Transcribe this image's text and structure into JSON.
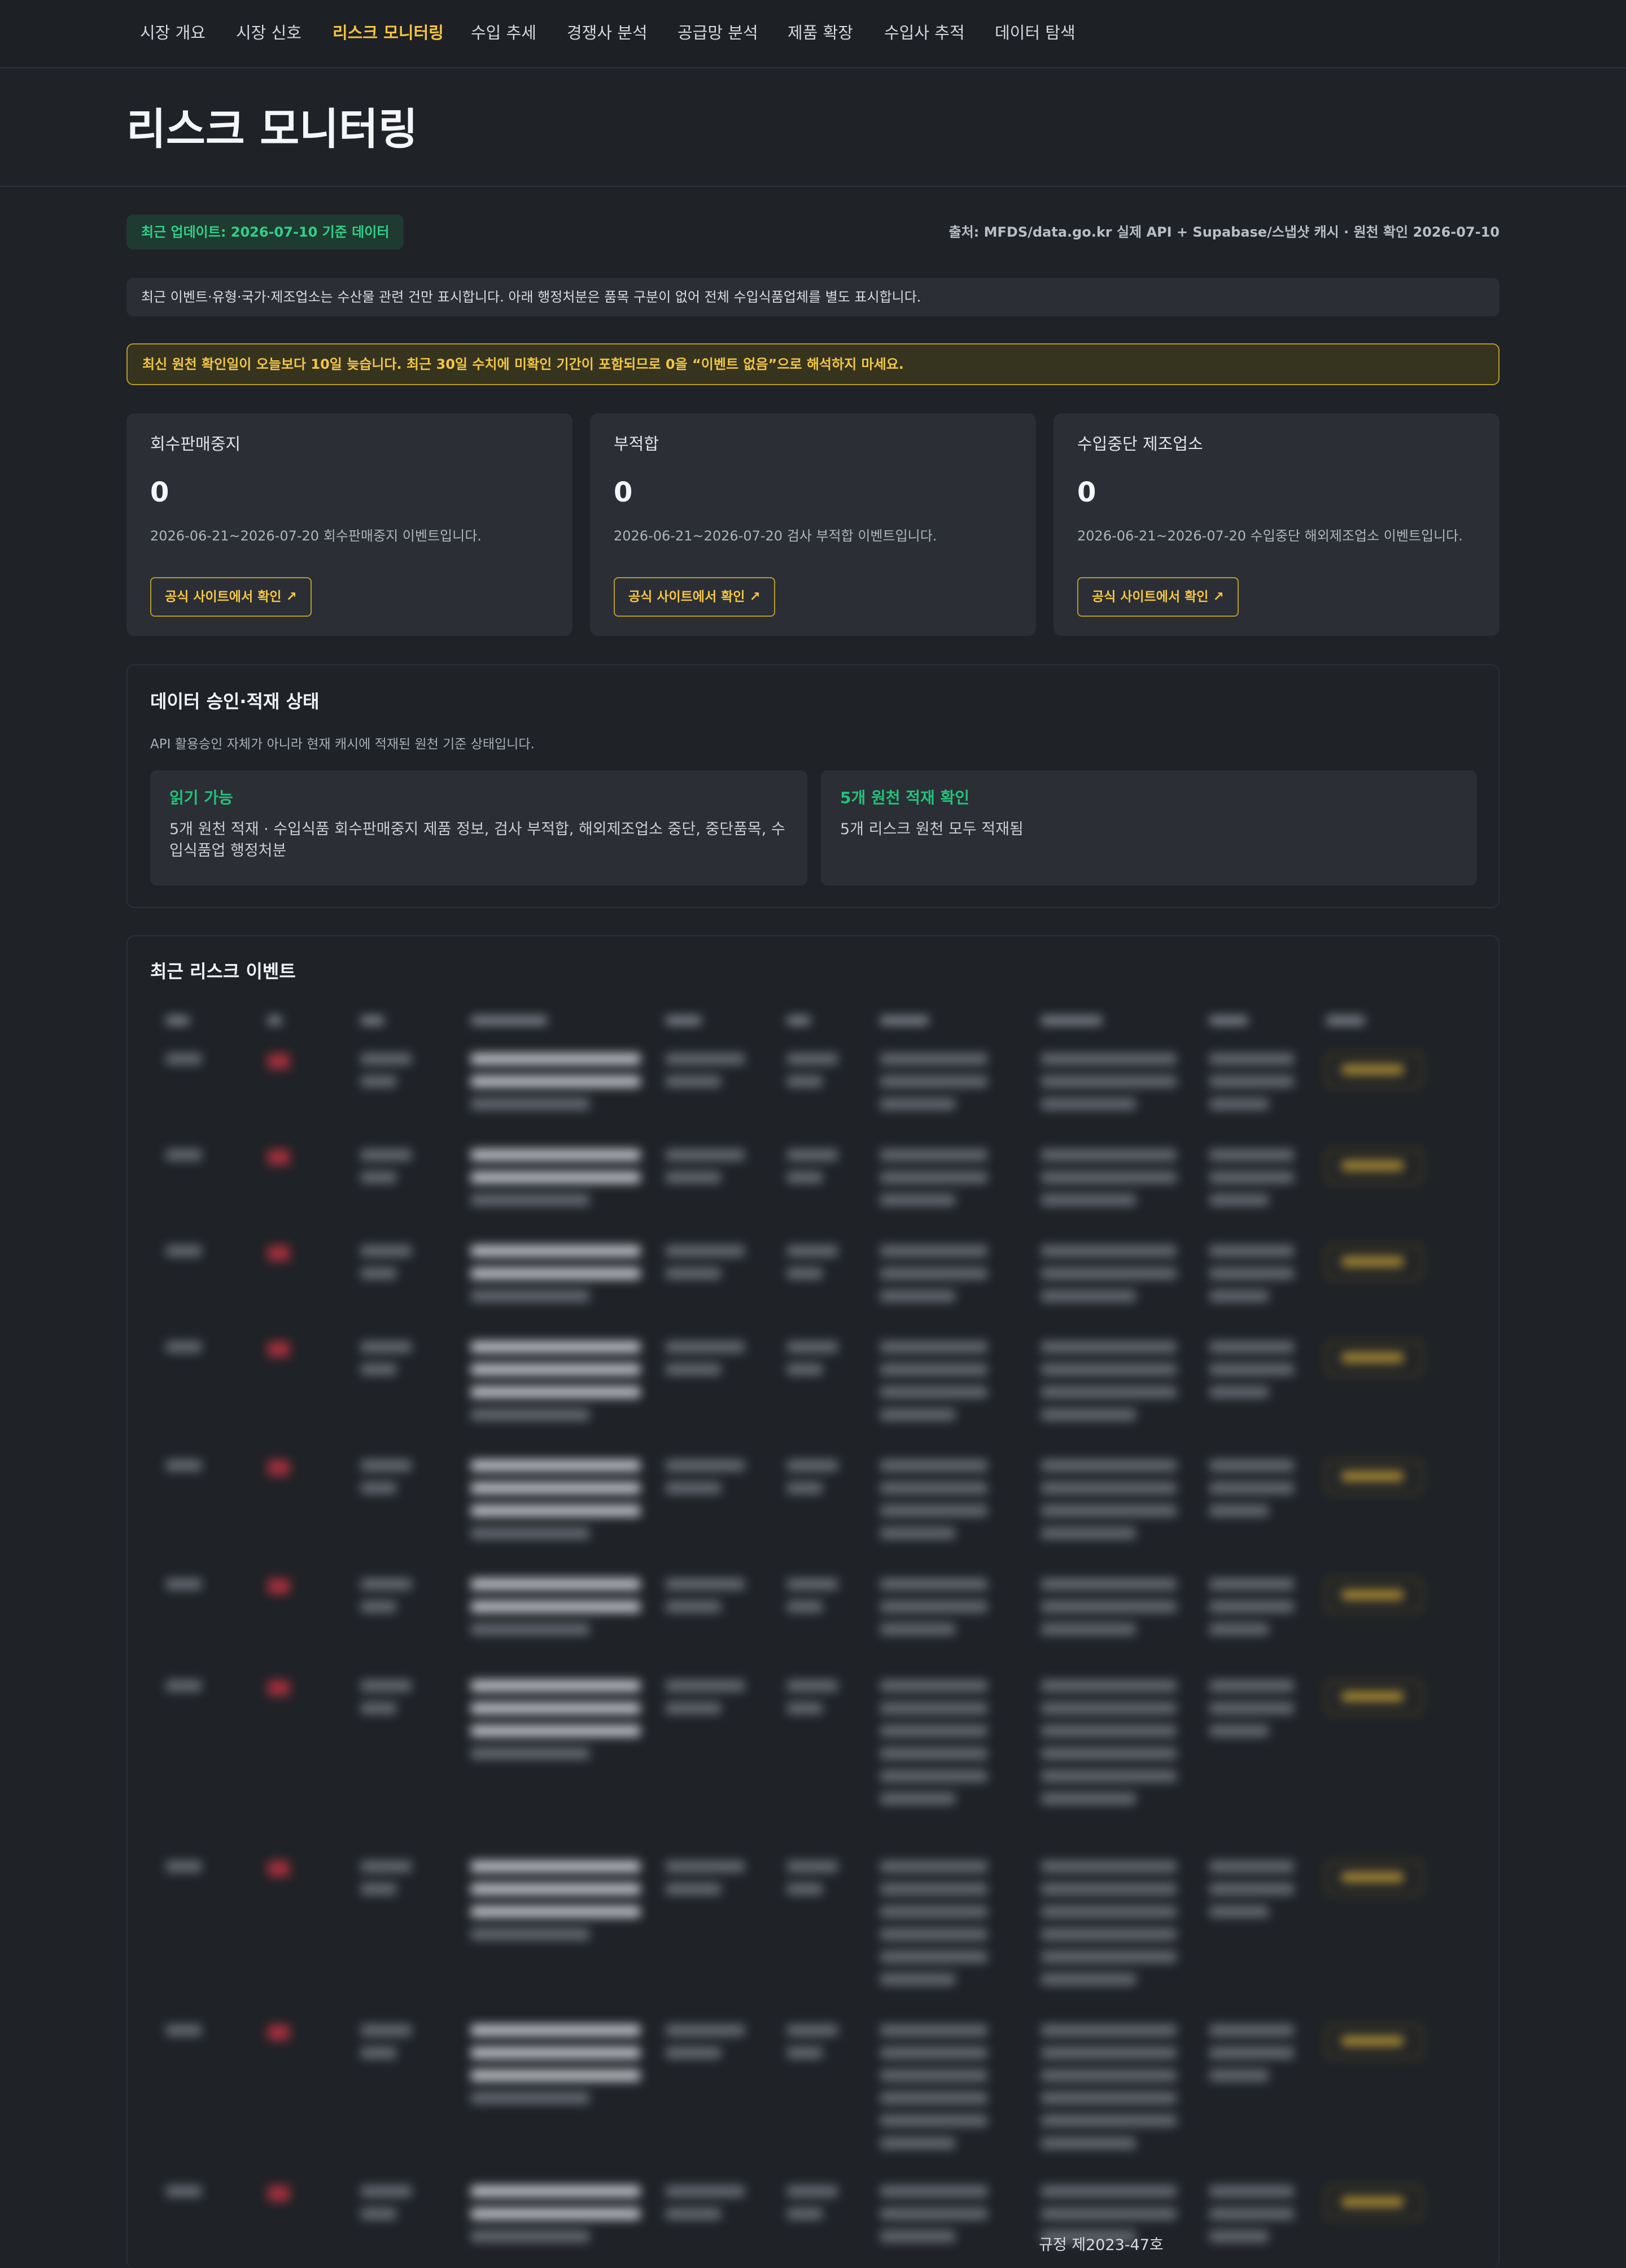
{
  "nav": {
    "tabs": [
      {
        "label": "시장 개요"
      },
      {
        "label": "시장 신호"
      },
      {
        "label": "리스크 모니터링",
        "active": true
      },
      {
        "label": "수입 추세"
      },
      {
        "label": "경쟁사 분석"
      },
      {
        "label": "공급망 분석"
      },
      {
        "label": "제품 확장"
      },
      {
        "label": "수입사 추적"
      },
      {
        "label": "데이터 탐색"
      }
    ]
  },
  "header": {
    "title": "리스크 모니터링"
  },
  "status": {
    "update_badge": "최근 업데이트: 2026-07-10 기준 데이터",
    "source": "출처: MFDS/data.go.kr 실제 API + Supabase/스냅샷 캐시 · 원천 확인 2026-07-10"
  },
  "info_note": "최근 이벤트·유형·국가·제조업소는 수산물 관련 건만 표시합니다. 아래 행정처분은 품목 구분이 없어 전체 수입식품업체를 별도 표시합니다.",
  "warning_note": "최신 원천 확인일이 오늘보다 10일 늦습니다. 최근 30일 수치에 미확인 기간이 포함되므로 0을 “이벤트 없음”으로 해석하지 마세요.",
  "cards": [
    {
      "title": "회수판매중지",
      "value": "0",
      "desc": "2026-06-21~2026-07-20 회수판매중지 이벤트입니다.",
      "button": "공식 사이트에서 확인 ↗"
    },
    {
      "title": "부적합",
      "value": "0",
      "desc": "2026-06-21~2026-07-20 검사 부적합 이벤트입니다.",
      "button": "공식 사이트에서 확인 ↗"
    },
    {
      "title": "수입중단 제조업소",
      "value": "0",
      "desc": "2026-06-21~2026-07-20 수입중단 해외제조업소 이벤트입니다.",
      "button": "공식 사이트에서 확인 ↗"
    }
  ],
  "data_status": {
    "title": "데이터 승인·적재 상태",
    "subtitle": "API 활용승인 자체가 아니라 현재 캐시에 적재된 원천 기준 상태입니다.",
    "items": [
      {
        "title": "읽기 가능",
        "text": "5개 원천 적재 · 수입식품 회수판매중지 제품 정보, 검사 부적합, 해외제조업소 중단, 중단품목, 수입식품업 행정처분"
      },
      {
        "title": "5개 원천 적재 확인",
        "text": "5개 리스크 원천 모두 적재됨"
      }
    ]
  },
  "events": {
    "title": "최근 리스크 이벤트",
    "footer_text": "규정 제2023-47호"
  },
  "colors": {
    "background": "#1f2227",
    "card": "#2b2f35",
    "accent_yellow": "#f5c542",
    "accent_green": "#2fd08a",
    "warning_border": "#b59a2c",
    "tag_red": "#b1313f"
  }
}
